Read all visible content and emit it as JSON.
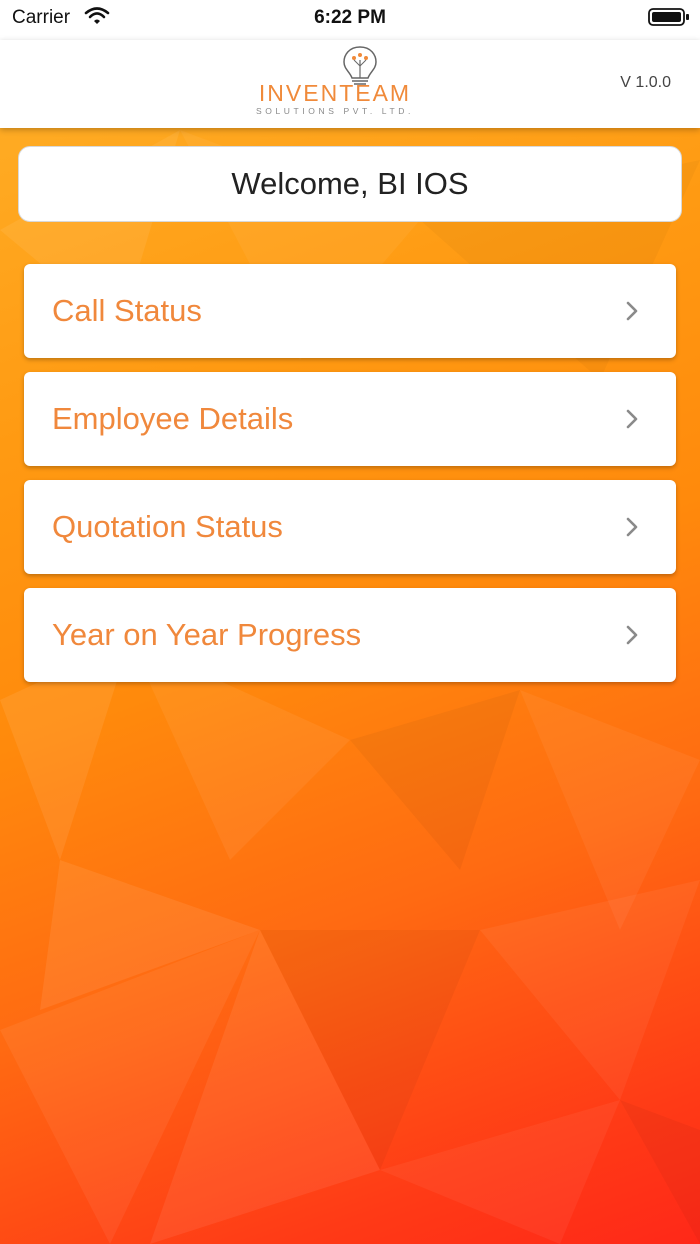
{
  "status_bar": {
    "carrier": "Carrier",
    "time": "6:22 PM",
    "wifi_icon": "wifi-icon",
    "battery_icon": "battery-icon"
  },
  "header": {
    "logo_word": "INVENTEAM",
    "logo_sub": "SOLUTIONS PVT. LTD.",
    "version": "V 1.0.0"
  },
  "welcome": {
    "text": "Welcome, BI IOS"
  },
  "menu": {
    "items": [
      {
        "label": "Call Status",
        "icon": "chevron-right-icon"
      },
      {
        "label": "Employee Details",
        "icon": "chevron-right-icon"
      },
      {
        "label": "Quotation Status",
        "icon": "chevron-right-icon"
      },
      {
        "label": "Year on Year Progress",
        "icon": "chevron-right-icon"
      }
    ]
  },
  "colors": {
    "accent": "#f0883c",
    "background_top": "#ffb22a",
    "background_bottom": "#ff2818"
  }
}
